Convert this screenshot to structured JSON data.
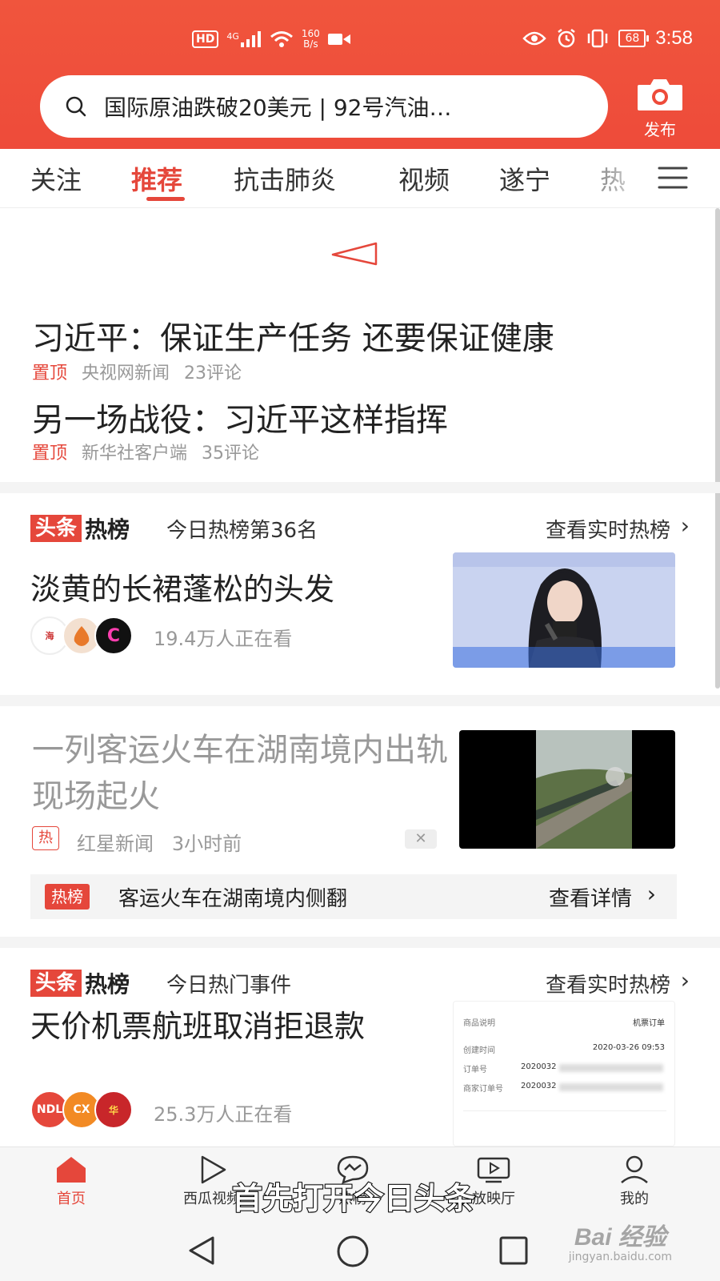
{
  "status_bar": {
    "hd": "HD",
    "network": "4G",
    "speed_value": "160",
    "speed_unit": "B/s",
    "battery": "68",
    "time": "3:58"
  },
  "search": {
    "text": "国际原油跌破20美元 | 92号汽油…",
    "publish_label": "发布"
  },
  "tabs": [
    "关注",
    "推荐",
    "抗击肺炎",
    "视频",
    "遂宁",
    "热"
  ],
  "top_stories": [
    {
      "title": "习近平：保证生产任务 还要保证健康",
      "pin": "置顶",
      "source": "央视网新闻",
      "comments": "23评论"
    },
    {
      "title": "另一场战役：习近平这样指挥",
      "pin": "置顶",
      "source": "新华社客户端",
      "comments": "35评论"
    }
  ],
  "hot_list_logo": {
    "toutiao": "头条",
    "rebang": "热榜"
  },
  "hot_card_1": {
    "subtitle": "今日热榜第36名",
    "link": "查看实时热榜",
    "title": "淡黄的长裙蓬松的头发",
    "viewers": "19.4万人正在看"
  },
  "news_item": {
    "title": "一列客运火车在湖南境内出轨 现场起火",
    "hot_tag": "热",
    "source": "红星新闻",
    "time": "3小时前",
    "dismiss": "✕"
  },
  "hot_bar": {
    "badge": "热榜",
    "text": "客运火车在湖南境内侧翻",
    "more": "查看详情"
  },
  "hot_card_2": {
    "subtitle": "今日热门事件",
    "link": "查看实时热榜",
    "title": "天价机票航班取消拒退款",
    "viewers": "25.3万人正在看"
  },
  "receipt": {
    "r1_label": "商品说明",
    "r1_value": "机票订单",
    "r2_label": "创建时间",
    "r2_value": "2020-03-26 09:53",
    "r3_label": "订单号",
    "r3_value": "2020032",
    "r4_label": "商家订单号",
    "r4_value": "2020032"
  },
  "bottom_nav": [
    {
      "label": "首页"
    },
    {
      "label": "西瓜视频"
    },
    {
      "label": "热榜"
    },
    {
      "label": "放映厅"
    },
    {
      "label": "我的"
    }
  ],
  "caption": "首先打开今日头条",
  "watermark": {
    "main": "Bai 经验",
    "sub": "jingyan.baidu.com"
  },
  "colors": {
    "brand": "#e5473b",
    "header": "#ee4b3a",
    "muted": "#999999"
  },
  "icons": [
    "search-icon",
    "camera-icon",
    "menu-icon",
    "home-icon",
    "play-icon",
    "chat-icon",
    "tv-icon",
    "person-icon",
    "back-icon",
    "home-circle-icon",
    "recent-icon"
  ]
}
